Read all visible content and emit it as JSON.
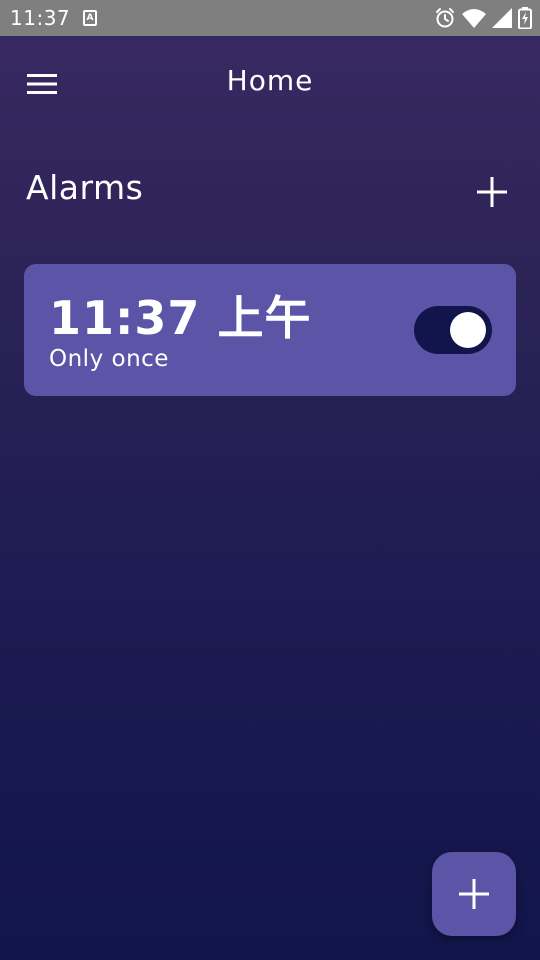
{
  "status_bar": {
    "time": "11:37",
    "notification_glyph": "A",
    "icons": [
      "alarm-icon",
      "wifi-icon",
      "signal-icon",
      "battery-charging-icon"
    ]
  },
  "app_bar": {
    "title": "Home",
    "menu_icon": "menu-icon"
  },
  "alarms_section": {
    "title": "Alarms",
    "add_icon": "plus-icon"
  },
  "alarms": [
    {
      "time": "11:37 上午",
      "repeat": "Only once",
      "enabled": true
    }
  ],
  "fab": {
    "icon": "plus-icon"
  },
  "colors": {
    "status_bar": "#7f7f7f",
    "background_top": "#3a2963",
    "background_bottom": "#11154a",
    "card": "#5c55a7",
    "toggle_track": "#12154b",
    "toggle_knob": "#ffffff",
    "text": "#ffffff"
  }
}
